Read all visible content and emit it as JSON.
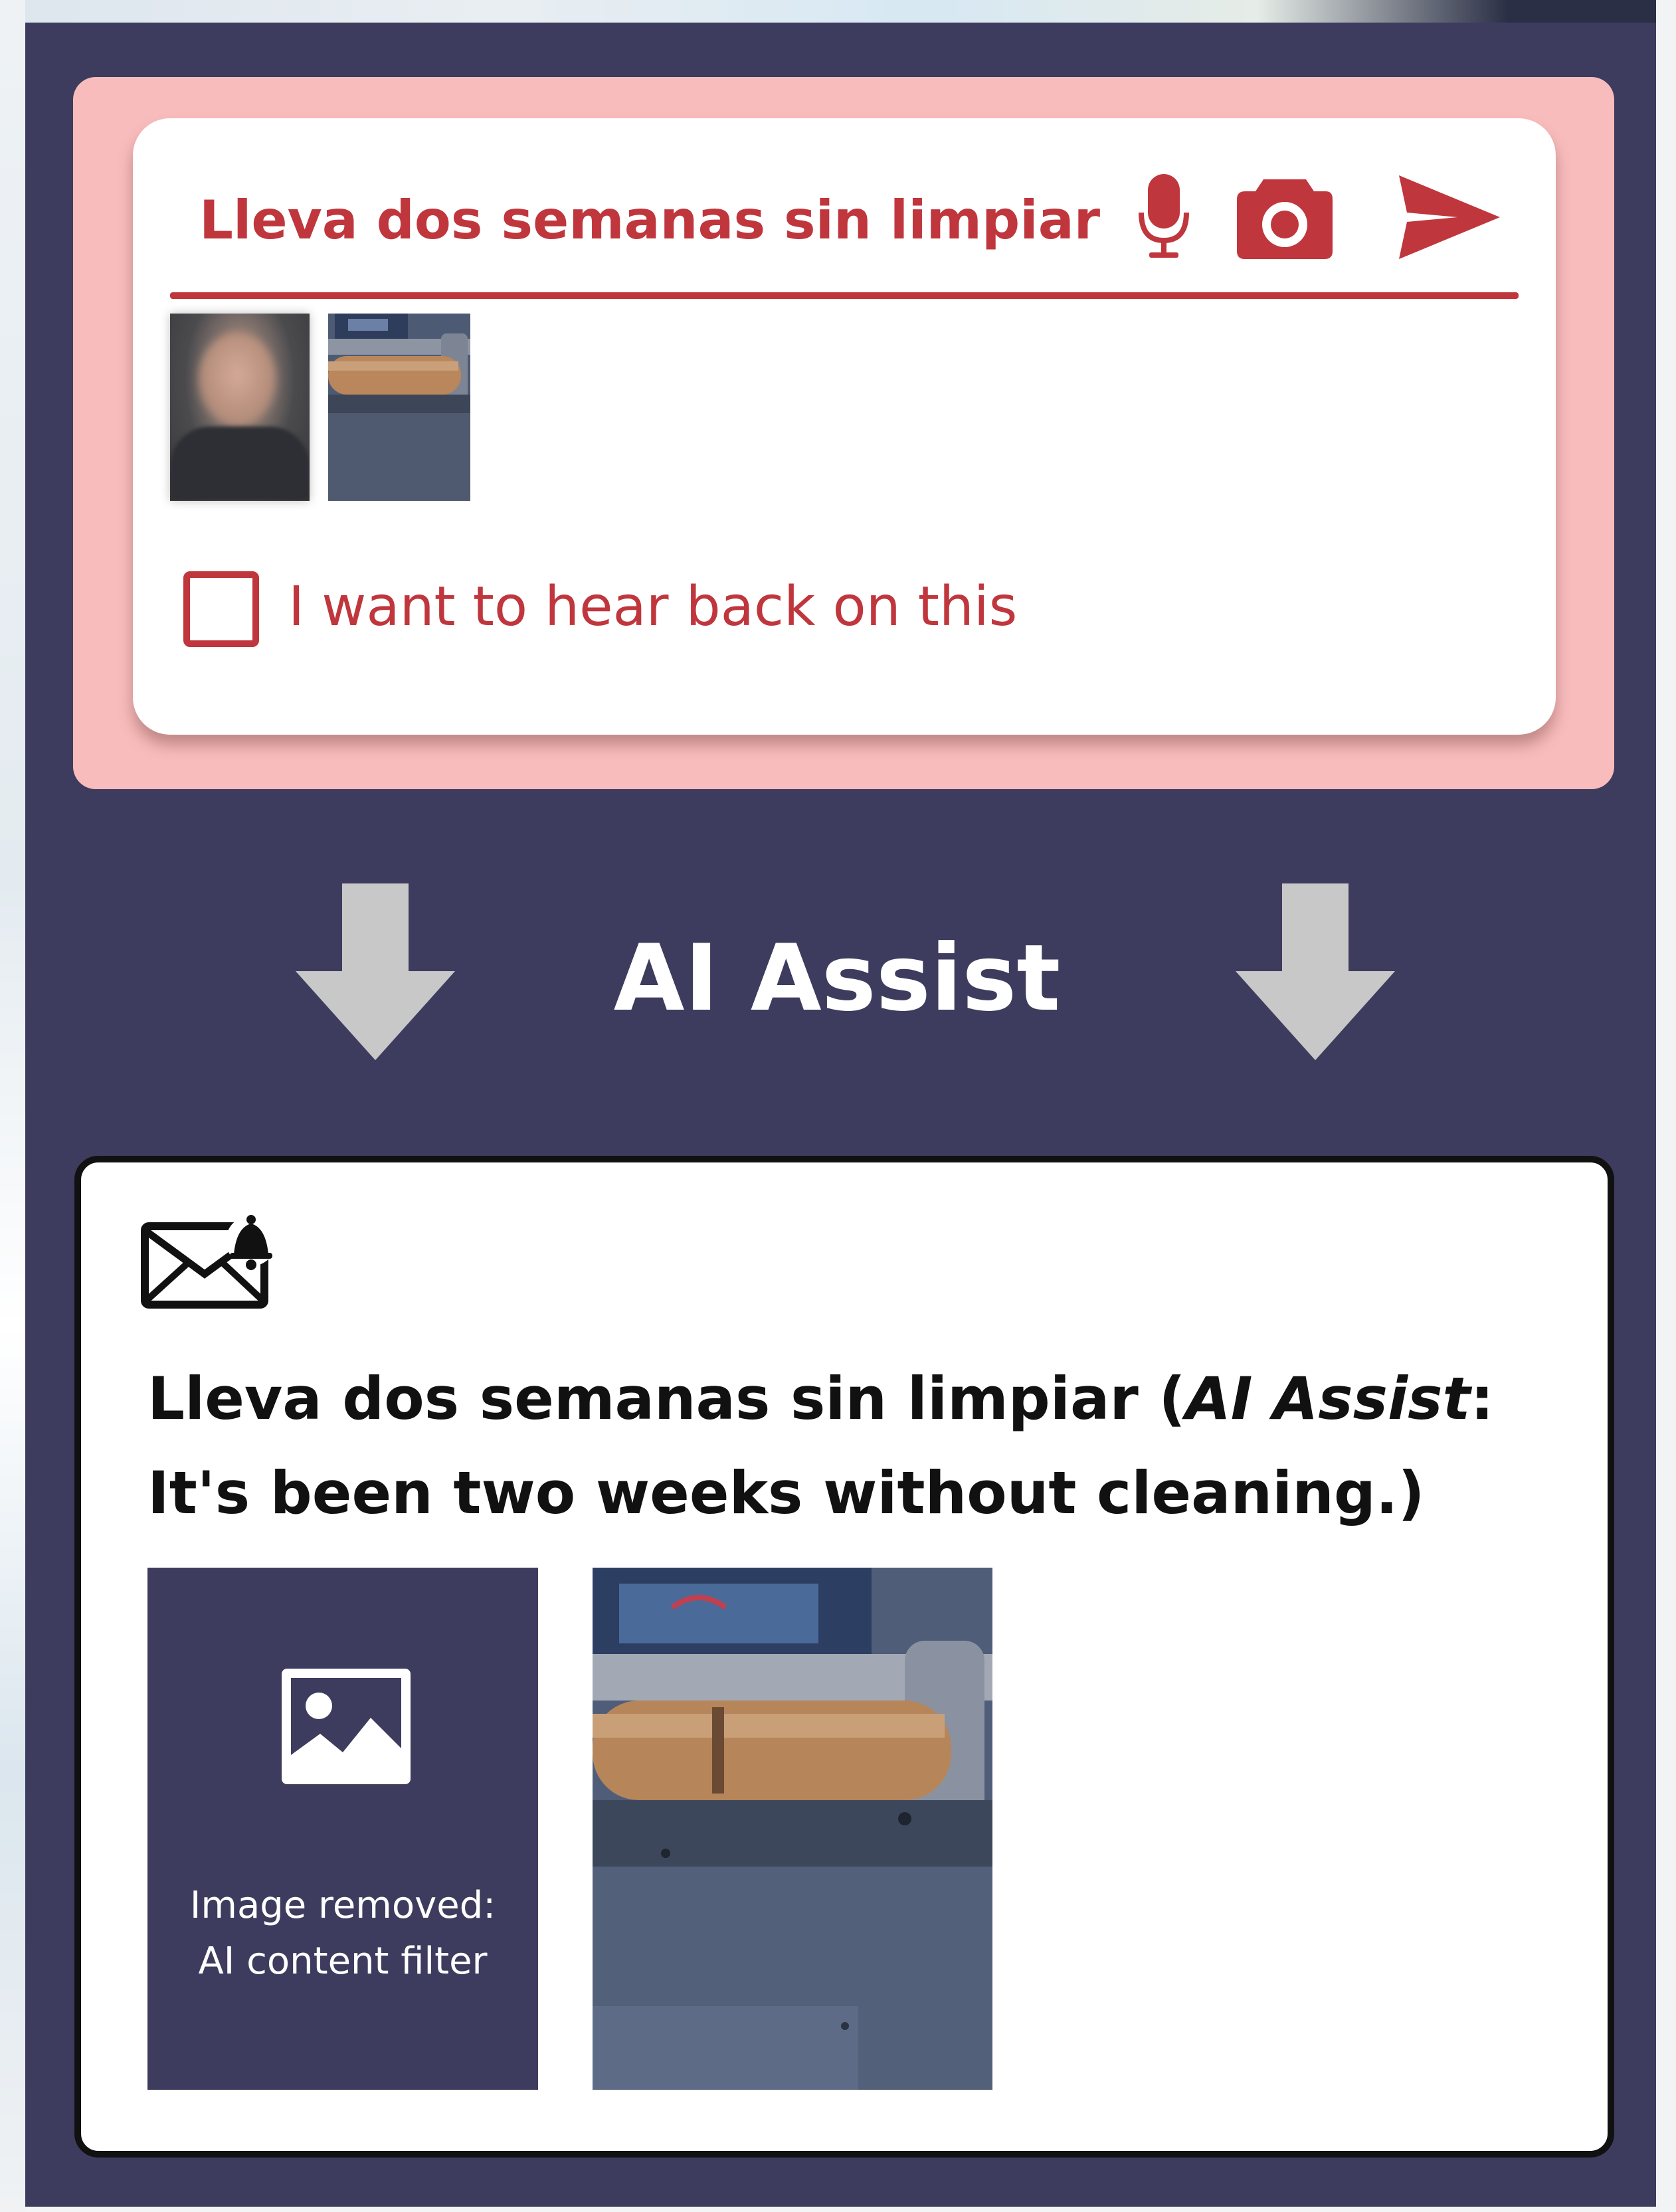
{
  "input": {
    "text": "Lleva dos semanas sin limpiar",
    "icons": [
      "microphone-icon",
      "camera-icon",
      "send-icon"
    ],
    "attachments": [
      "photo-person-blurred",
      "photo-seat-back"
    ],
    "checkbox_label": "I want to hear back on this",
    "checkbox_checked": false
  },
  "assist": {
    "title": "AI Assist"
  },
  "output": {
    "icon": "mail-alert-icon",
    "original_text": "Lleva dos semanas sin limpiar",
    "open_paren": " (",
    "assist_label": "AI Assist",
    "translation": ": It's been two weeks without cleaning.)",
    "removed_line1": "Image removed:",
    "removed_line2": "AI content filter"
  },
  "colors": {
    "panel_bg": "#3d3c5e",
    "input_zone_bg": "#f9bcbc",
    "accent_red": "#c0363d",
    "arrow_gray": "#c8c8c8"
  }
}
